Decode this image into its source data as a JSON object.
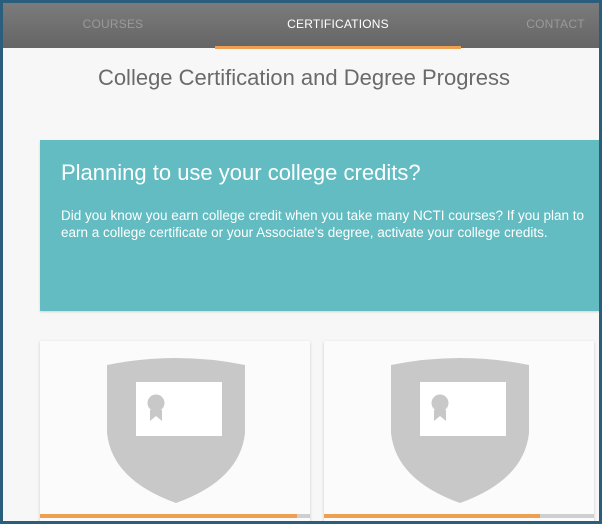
{
  "nav": {
    "tabs": [
      {
        "label": "COURSES",
        "active": false
      },
      {
        "label": "CERTIFICATIONS",
        "active": true
      },
      {
        "label": "CONTACT",
        "active": false
      }
    ]
  },
  "main": {
    "title": "College Certification and Degree Progress",
    "banner": {
      "title": "Planning to use your college credits?",
      "body": "Did you know you earn college credit when you take many NCTI courses? If you plan to earn a college certificate or your Associate's degree, activate your college credits."
    },
    "cards": [
      {
        "icon": "certificate-shield-icon",
        "progress": 0.95
      },
      {
        "icon": "certificate-shield-icon",
        "progress": 0.8
      }
    ]
  },
  "colors": {
    "accent": "#ef9f52",
    "banner": "#62bcc1",
    "nav": "#6e6e6e",
    "frame": "#2b5d7c"
  }
}
